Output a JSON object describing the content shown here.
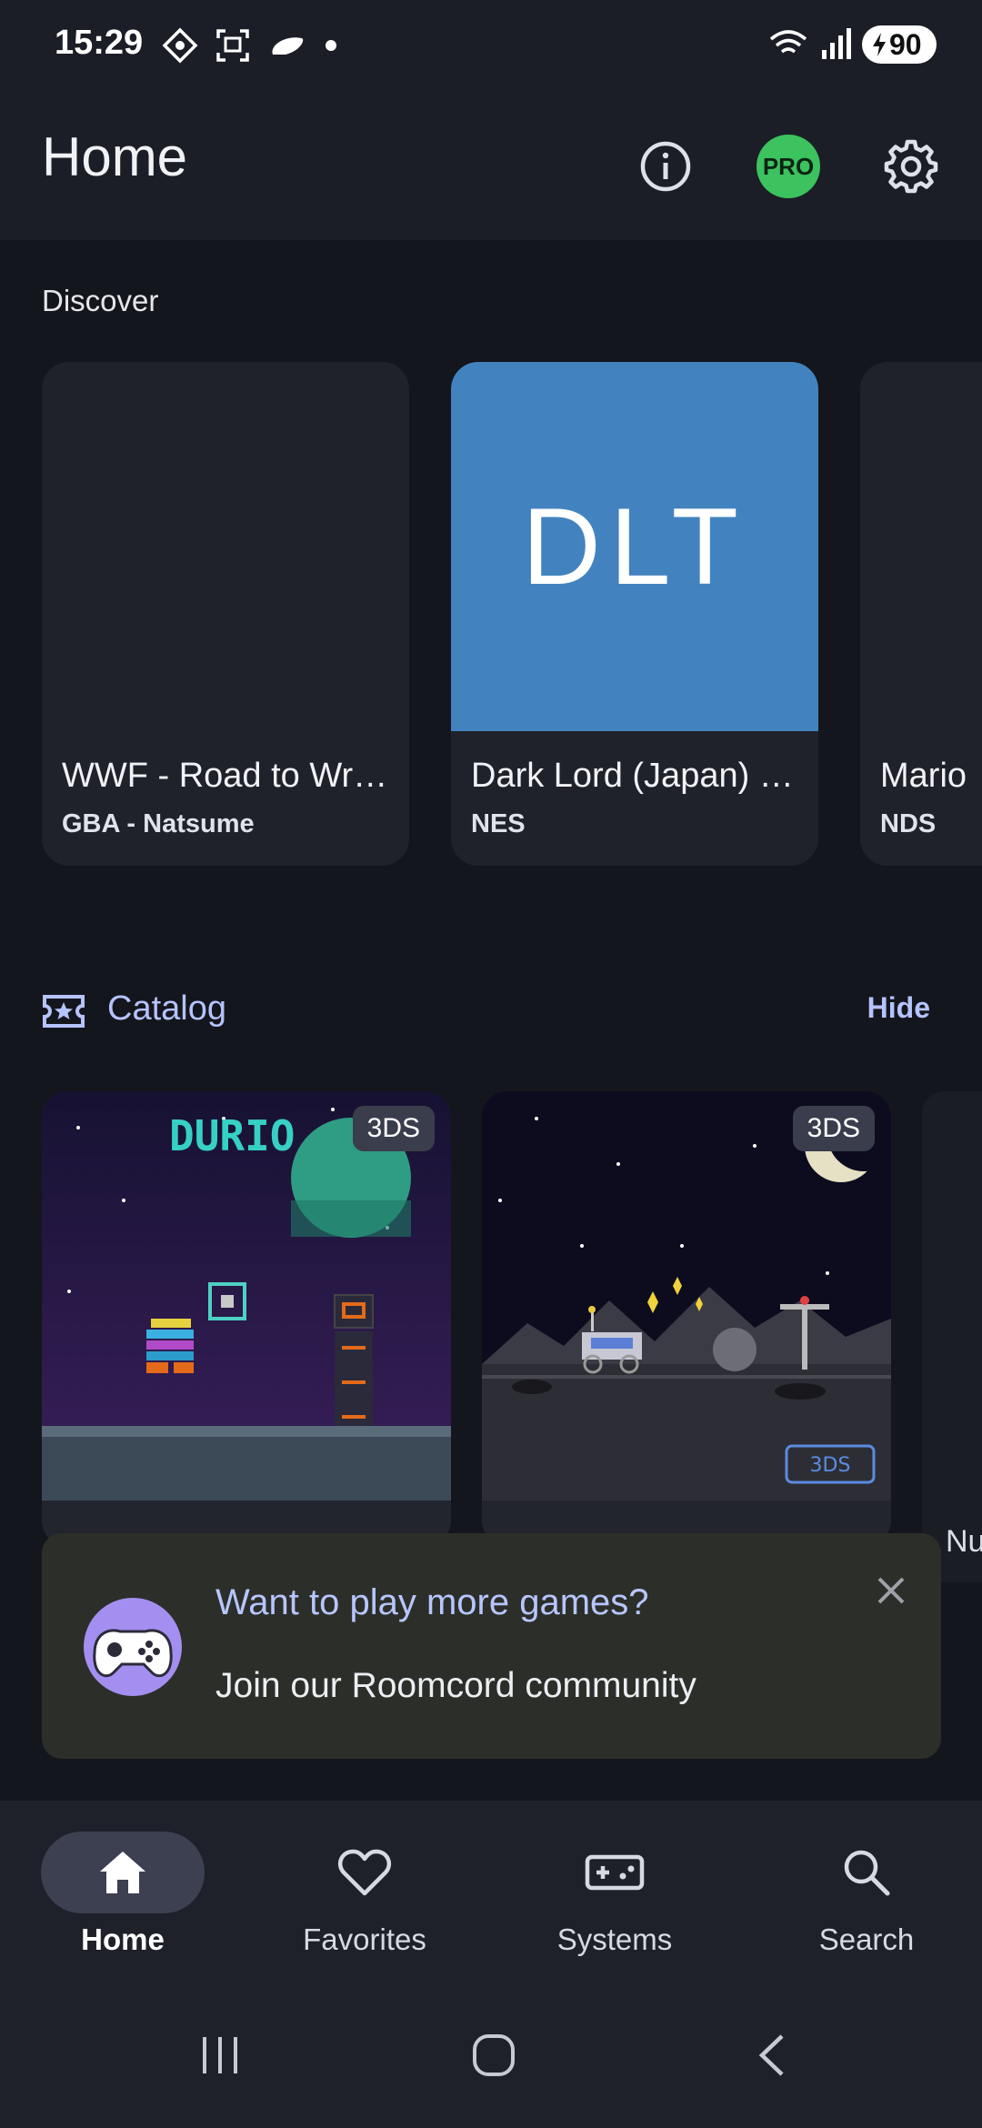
{
  "status": {
    "time": "15:29",
    "battery": "90"
  },
  "app_bar": {
    "title": "Home"
  },
  "discover": {
    "label": "Discover",
    "cards": [
      {
        "title": "WWF - Road to Wr…",
        "subtitle": "GBA - Natsume"
      },
      {
        "title": "Dark Lord (Japan) …",
        "subtitle": "NES",
        "cover_text": "DLT",
        "cover_color": "#4283bf"
      },
      {
        "title": "Mario",
        "subtitle": "NDS"
      }
    ]
  },
  "catalog": {
    "label": "Catalog",
    "hide_label": "Hide",
    "cards": [
      {
        "tag": "3DS",
        "logo_text": "DURIO"
      },
      {
        "tag": "3DS",
        "corner_tag": "3DS"
      }
    ],
    "peek_text": "Nu"
  },
  "banner": {
    "title": "Want to play more games?",
    "subtitle": "Join our Roomcord community"
  },
  "nav": {
    "items": [
      {
        "label": "Home",
        "icon": "home-icon"
      },
      {
        "label": "Favorites",
        "icon": "heart-icon"
      },
      {
        "label": "Systems",
        "icon": "gamepad-icon"
      },
      {
        "label": "Search",
        "icon": "search-icon"
      }
    ]
  },
  "pro_label": "PRO",
  "colors": {
    "accent": "#b5c3ff",
    "pro": "#3cc25f",
    "background": "#14161d"
  }
}
